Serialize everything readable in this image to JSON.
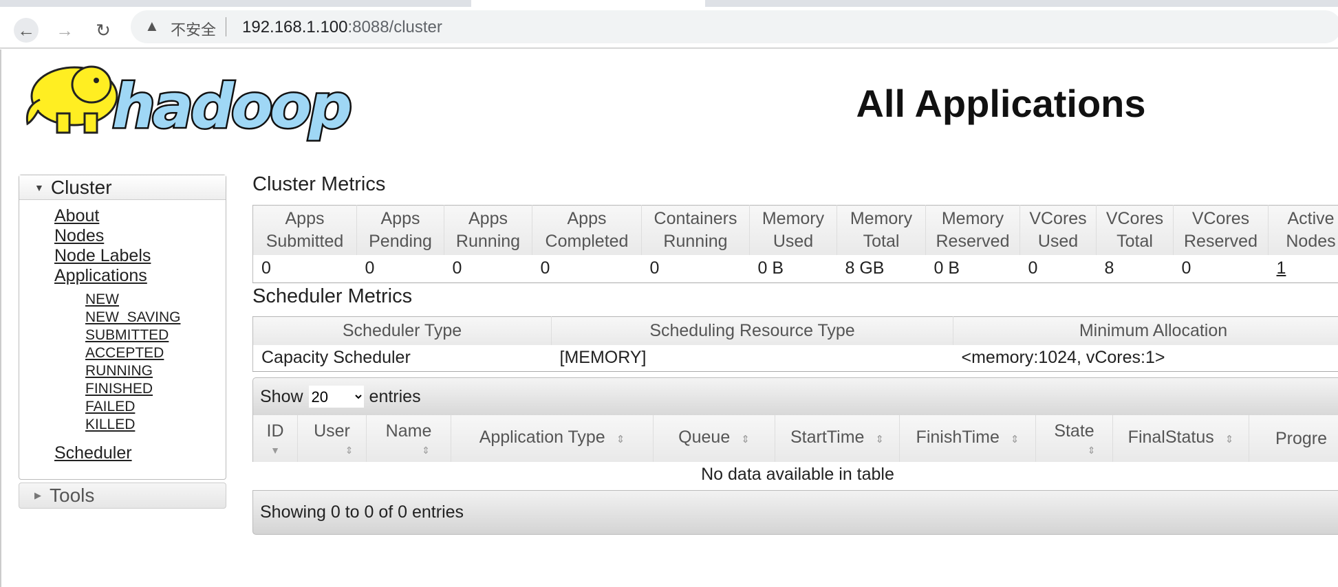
{
  "browser": {
    "insecure_label": "不安全",
    "url_host": "192.168.1.100",
    "url_rest": ":8088/cluster"
  },
  "logo": {
    "text": "hadoop"
  },
  "page_title": "All Applications",
  "sidebar": {
    "cluster_label": "Cluster",
    "links": [
      "About",
      "Nodes",
      "Node Labels",
      "Applications"
    ],
    "app_states": [
      "NEW",
      "NEW_SAVING",
      "SUBMITTED",
      "ACCEPTED",
      "RUNNING",
      "FINISHED",
      "FAILED",
      "KILLED"
    ],
    "scheduler": "Scheduler",
    "tools_label": "Tools"
  },
  "cluster_metrics": {
    "title": "Cluster Metrics",
    "headers": [
      [
        "Apps",
        "Submitted"
      ],
      [
        "Apps",
        "Pending"
      ],
      [
        "Apps",
        "Running"
      ],
      [
        "Apps",
        "Completed"
      ],
      [
        "Containers",
        "Running"
      ],
      [
        "Memory",
        "Used"
      ],
      [
        "Memory",
        "Total"
      ],
      [
        "Memory",
        "Reserved"
      ],
      [
        "VCores",
        "Used"
      ],
      [
        "VCores",
        "Total"
      ],
      [
        "VCores",
        "Reserved"
      ],
      [
        "Active",
        "Nodes"
      ]
    ],
    "values": [
      "0",
      "0",
      "0",
      "0",
      "0",
      "0 B",
      "8 GB",
      "0 B",
      "0",
      "8",
      "0",
      "1"
    ]
  },
  "scheduler_metrics": {
    "title": "Scheduler Metrics",
    "headers": [
      "Scheduler Type",
      "Scheduling Resource Type",
      "Minimum Allocation"
    ],
    "values": [
      "Capacity Scheduler",
      "[MEMORY]",
      "<memory:1024, vCores:1>"
    ]
  },
  "apps_table": {
    "show_label": "Show",
    "page_size": "20",
    "entries_label": "entries",
    "headers": [
      "ID",
      "User",
      "Name",
      "Application Type",
      "Queue",
      "StartTime",
      "FinishTime",
      "State",
      "FinalStatus",
      "Progre"
    ],
    "empty_message": "No data available in table",
    "footer": "Showing 0 to 0 of 0 entries"
  }
}
